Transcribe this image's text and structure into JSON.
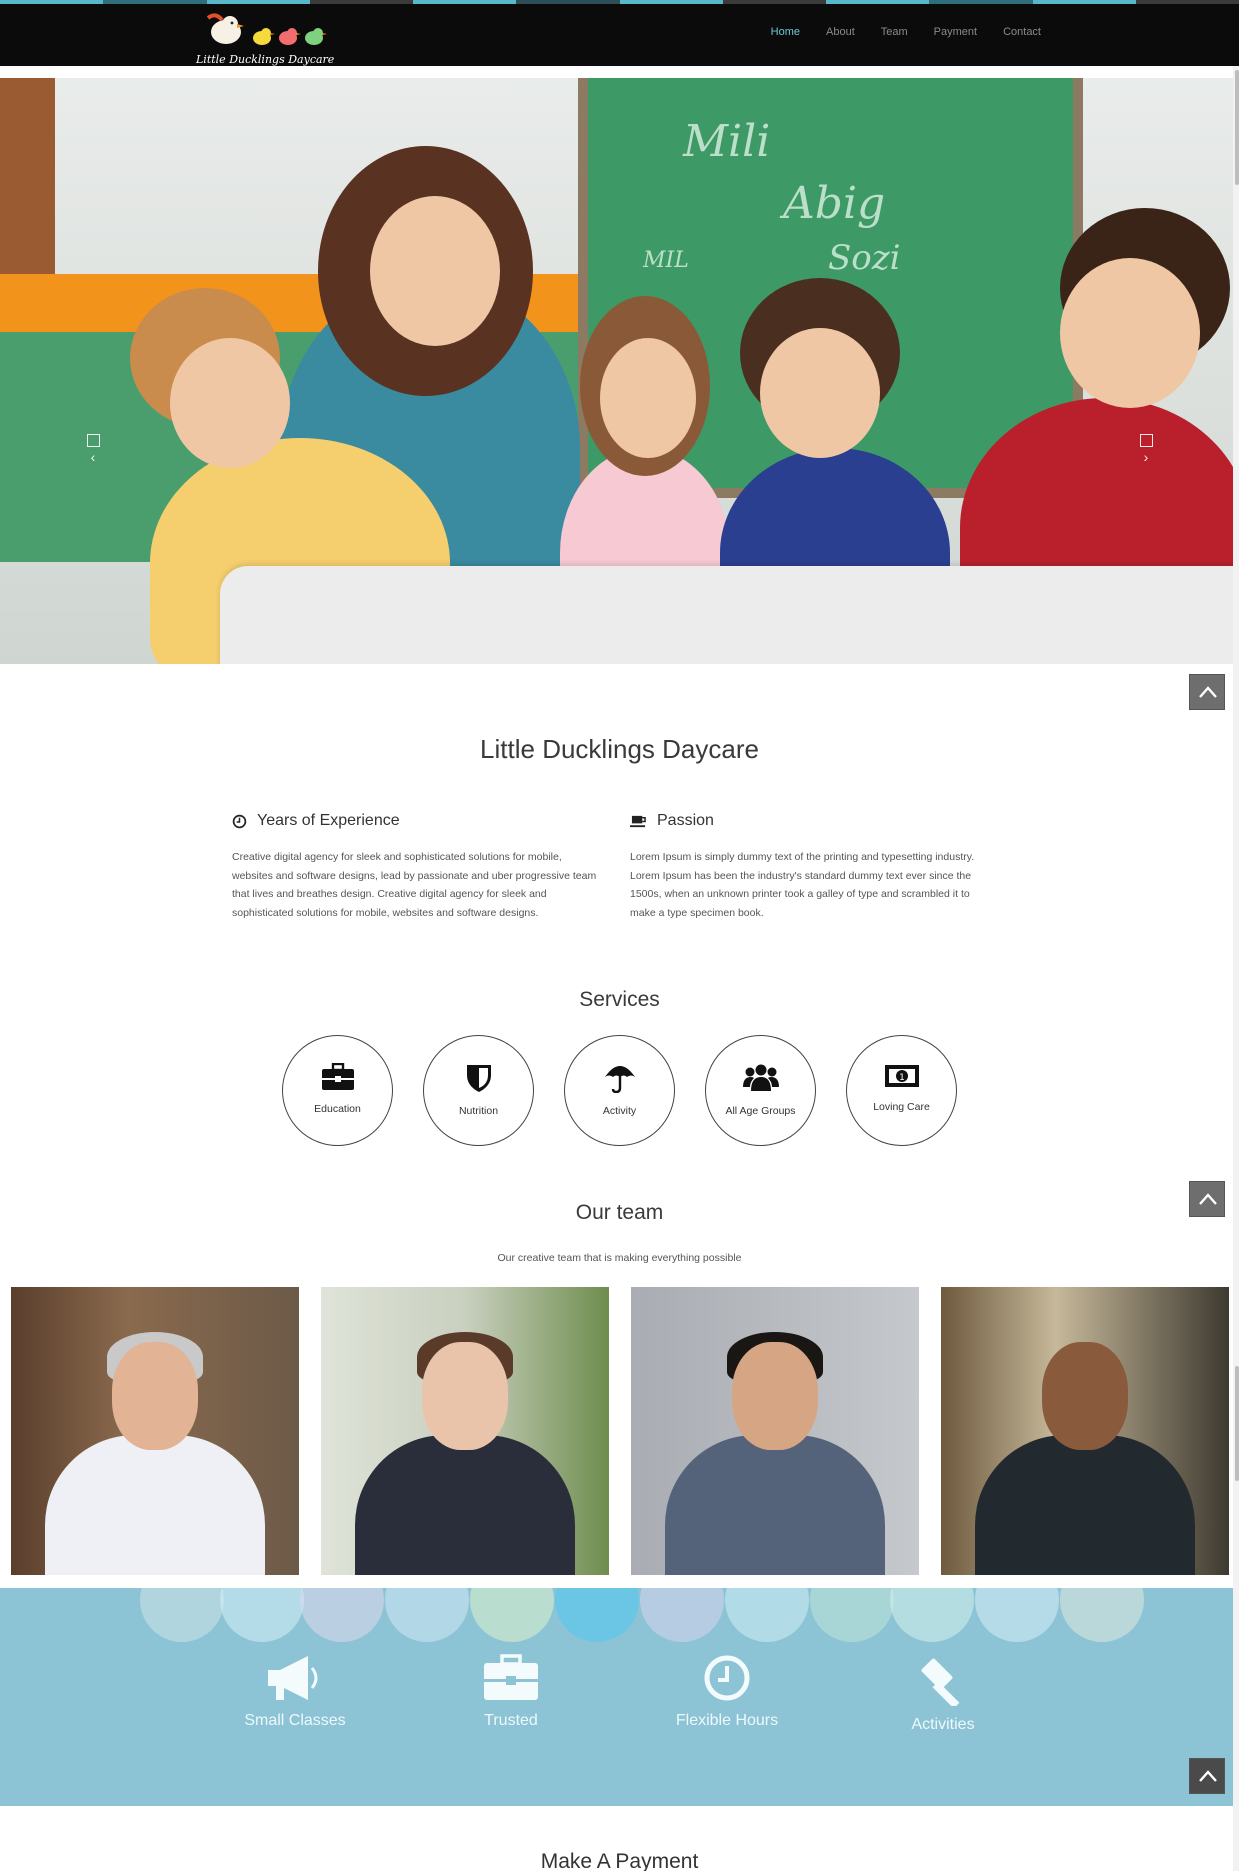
{
  "nav": {
    "brand": "Little Ducklings Daycare",
    "links": [
      "Home",
      "About",
      "Team",
      "Payment",
      "Contact"
    ]
  },
  "hero": {
    "board_text_1": "Mili",
    "board_text_2": "Abig",
    "board_text_3": "MIL",
    "board_text_4": "Sozi"
  },
  "about": {
    "title": "Little Ducklings Daycare",
    "col1": {
      "heading": "Years of Experience",
      "icon": "clock-icon",
      "text": "Creative digital agency for sleek and sophisticated solutions for mobile, websites and software designs, lead by passionate and uber progressive team that lives and breathes design. Creative digital agency for sleek and sophisticated solutions for mobile, websites and software designs."
    },
    "col2": {
      "heading": "Passion",
      "icon": "coffee-icon",
      "text": "Lorem Ipsum is simply dummy text of the printing and typesetting industry. Lorem Ipsum has been the industry's standard dummy text ever since the 1500s, when an unknown printer took a galley of type and scrambled it to make a type specimen book."
    }
  },
  "services": {
    "title": "Services",
    "items": [
      {
        "label": "Education",
        "icon": "briefcase-icon"
      },
      {
        "label": "Nutrition",
        "icon": "shield-icon"
      },
      {
        "label": "Activity",
        "icon": "umbrella-icon"
      },
      {
        "label": "All Age Groups",
        "icon": "group-icon"
      },
      {
        "label": "Loving Care",
        "icon": "money-icon"
      }
    ]
  },
  "team": {
    "title": "Our team",
    "subtitle": "Our creative team that is making everything possible"
  },
  "features": {
    "items": [
      {
        "label": "Small Classes",
        "icon": "megaphone-icon"
      },
      {
        "label": "Trusted",
        "icon": "briefcase-icon"
      },
      {
        "label": "Flexible Hours",
        "icon": "clock-icon"
      },
      {
        "label": "Activities",
        "icon": "gavel-icon"
      }
    ]
  },
  "payment": {
    "title": "Make A Payment"
  },
  "colors": {
    "nav_bg": "#0b0b0b",
    "nav_active": "#6fc7d6",
    "features_bg": "#8cc4d6",
    "to_top_bg": "#6e6e6e"
  }
}
